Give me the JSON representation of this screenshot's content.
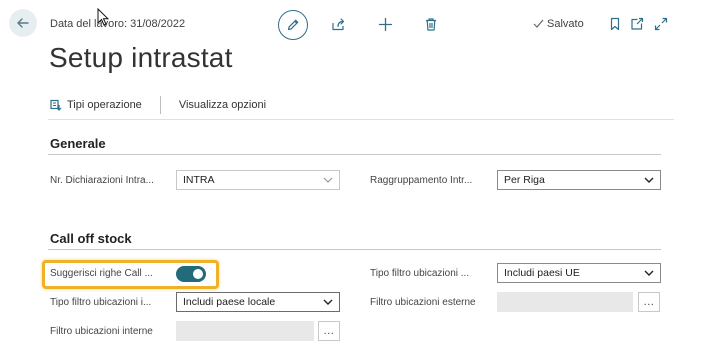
{
  "header": {
    "work_date": "Data del lavoro: 31/08/2022",
    "saved_label": "Salvato"
  },
  "page": {
    "title": "Setup intrastat"
  },
  "actions": {
    "transaction_types": "Tipi operazione",
    "display_options": "Visualizza opzioni"
  },
  "sections": {
    "general": {
      "title": "Generale",
      "intrastat_nos_label": "Nr. Dichiarazioni Intra...",
      "intrastat_nos_value": "INTRA",
      "grouping_label": "Raggruppamento Intr...",
      "grouping_value": "Per Riga"
    },
    "call_off_stock": {
      "title": "Call off stock",
      "suggest_lines_label": "Suggerisci righe Call ...",
      "suggest_lines_enabled": true,
      "internal_filter_type_label": "Tipo filtro ubicazioni i...",
      "internal_filter_type_value": "Includi paese locale",
      "internal_filter_label": "Filtro ubicazioni interne",
      "internal_filter_value": "",
      "external_filter_type_label": "Tipo filtro ubicazioni ...",
      "external_filter_type_value": "Includi paesi UE",
      "external_filter_label": "Filtro ubicazioni esterne",
      "external_filter_value": "",
      "lookup_button": "..."
    }
  },
  "colors": {
    "accent": "#2f6f89",
    "toggle_on": "#236b7b",
    "highlight": "#f0b028"
  }
}
